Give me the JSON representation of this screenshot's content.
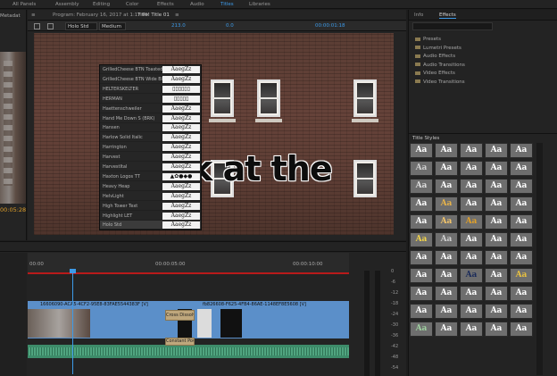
{
  "workspace_tabs": [
    {
      "label": "All Panels",
      "active": false
    },
    {
      "label": "Assembly",
      "active": false
    },
    {
      "label": "Editing",
      "active": false
    },
    {
      "label": "Color",
      "active": false
    },
    {
      "label": "Effects",
      "active": false
    },
    {
      "label": "Audio",
      "active": false
    },
    {
      "label": "Titles",
      "active": true
    },
    {
      "label": "Libraries",
      "active": false
    }
  ],
  "left_panel": {
    "header": "Metadat",
    "timecode": "00:05:28"
  },
  "program": {
    "header": "Program: February 16, 2017 at 1:17 PM",
    "title_label": "Title: Title 01"
  },
  "title_toolbar": {
    "font_family": "Holo Std",
    "font_style": "Medium",
    "size": "213.0",
    "kerning": "0.0",
    "timecode": "00:00:01:18"
  },
  "overlay_text": "ok at the",
  "font_list": {
    "selected_index": 18,
    "items": [
      {
        "name": "GrilledCheese BTN Toasted",
        "preview": "AaegZz"
      },
      {
        "name": "GrilledCheese BTN Wide Blk",
        "preview": "AaegZz"
      },
      {
        "name": "HELTERSKELTER",
        "preview": "▯▯▯▯▯▯"
      },
      {
        "name": "HERMAN",
        "preview": "▯▯▯▯▯"
      },
      {
        "name": "Haettenschweiler",
        "preview": "AaegZz"
      },
      {
        "name": "Hand Me Down S (BRK)",
        "preview": "AaegZz"
      },
      {
        "name": "Hansen",
        "preview": "AaegZz"
      },
      {
        "name": "Harlow Solid Italic",
        "preview": "AaegZz"
      },
      {
        "name": "Harrington",
        "preview": "AaegZz"
      },
      {
        "name": "Harvest",
        "preview": "AaegZz"
      },
      {
        "name": "HarvestItal",
        "preview": "AaegZz"
      },
      {
        "name": "Haxton Logos TT",
        "preview": "▲✿●◆●"
      },
      {
        "name": "Heavy Heap",
        "preview": "AaegZz"
      },
      {
        "name": "HelvLight",
        "preview": "AaegZz"
      },
      {
        "name": "High Tower Text",
        "preview": "AaegZz"
      },
      {
        "name": "Highlight LET",
        "preview": "AaegZz"
      },
      {
        "name": "Holo Std",
        "preview": "AaegZz"
      }
    ]
  },
  "right_panel": {
    "tabs": [
      {
        "label": "Info",
        "active": false
      },
      {
        "label": "Effects",
        "active": true
      }
    ],
    "effects": [
      "Presets",
      "Lumetri Presets",
      "Audio Effects",
      "Audio Transitions",
      "Video Effects",
      "Video Transitions"
    ],
    "title_styles_header": "Title Styles",
    "swatch_label": "Aa"
  },
  "timeline": {
    "ruler_labels": [
      "00:00",
      "00:00:05:00",
      "00:00:10:00"
    ],
    "clip1_label": "16606090-ACA5-4CF2-95E8-83FAE5544383F [V]",
    "clip2_label": "fb826608-F625-4FB4-86AE-1148EF8E5608 [V]",
    "transition_video": "Cross Dissolv",
    "transition_audio": "Constant Pow",
    "meter_scale": [
      "0",
      "-6",
      "-12",
      "-18",
      "-24",
      "-30",
      "-36",
      "-42",
      "-48",
      "-54"
    ]
  }
}
